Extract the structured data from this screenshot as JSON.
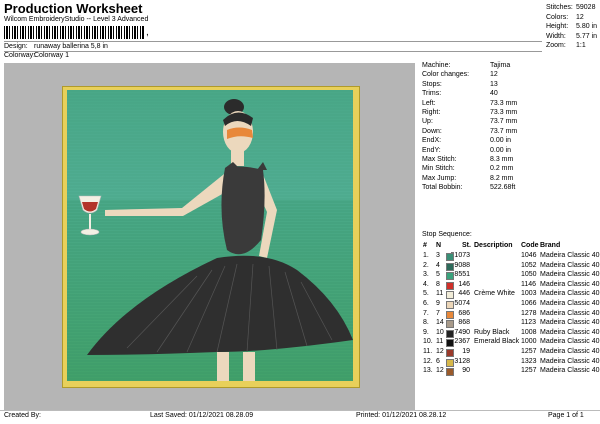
{
  "header": {
    "title": "Production Worksheet",
    "subtitle": "Wilcom EmbroideryStudio -- Level 3 Advanced",
    "barcode_mark": ",",
    "design_label": "Design:",
    "design_value": "runaway ballerina 5,8 in",
    "colorway_label": "Colorway:",
    "colorway_value": "Colorway 1"
  },
  "header_stats": [
    {
      "label": "Stitches:",
      "value": "59028"
    },
    {
      "label": "Colors:",
      "value": "12"
    },
    {
      "label": "Height:",
      "value": "5.80 in"
    },
    {
      "label": "Width:",
      "value": "5.77 in"
    },
    {
      "label": "Zoom:",
      "value": "1:1"
    }
  ],
  "info": [
    {
      "label": "Machine:",
      "value": "Tajima"
    },
    {
      "label": "Color changes:",
      "value": "12"
    },
    {
      "label": "Stops:",
      "value": "13"
    },
    {
      "label": "Trims:",
      "value": "40"
    },
    {
      "label": "Left:",
      "value": "73.3 mm"
    },
    {
      "label": "Right:",
      "value": "73.3 mm"
    },
    {
      "label": "Up:",
      "value": "73.7 mm"
    },
    {
      "label": "Down:",
      "value": "73.7 mm"
    },
    {
      "label": "EndX:",
      "value": "0.00 in"
    },
    {
      "label": "EndY:",
      "value": "0.00 in"
    },
    {
      "label": "Max Stitch:",
      "value": "8.3 mm"
    },
    {
      "label": "Min Stitch:",
      "value": "0.2 mm"
    },
    {
      "label": "Max Jump:",
      "value": "8.2 mm"
    },
    {
      "label": "Total Bobbin:",
      "value": "522.68ft"
    }
  ],
  "stop_sequence_label": "Stop Sequence:",
  "stop_columns": {
    "num": "#",
    "n": "N",
    "st": "St.",
    "description": "Description",
    "code": "Code",
    "brand": "Brand"
  },
  "stops": [
    {
      "num": "1.",
      "n": "3",
      "st": "21073",
      "description": "",
      "code": "1046",
      "brand": "Madeira Classic 40",
      "color": "#3a8f76"
    },
    {
      "num": "2.",
      "n": "4",
      "st": "9088",
      "description": "",
      "code": "1052",
      "brand": "Madeira Classic 40",
      "color": "#2e6a5a"
    },
    {
      "num": "3.",
      "n": "5",
      "st": "8551",
      "description": "",
      "code": "1050",
      "brand": "Madeira Classic 40",
      "color": "#3aa27c"
    },
    {
      "num": "4.",
      "n": "8",
      "st": "146",
      "description": "",
      "code": "1146",
      "brand": "Madeira Classic 40",
      "color": "#d0302a"
    },
    {
      "num": "5.",
      "n": "11",
      "st": "446",
      "description": "Crème White",
      "code": "1003",
      "brand": "Madeira Classic 40",
      "color": "#f1ecd8"
    },
    {
      "num": "6.",
      "n": "9",
      "st": "5074",
      "description": "",
      "code": "1066",
      "brand": "Madeira Classic 40",
      "color": "#ecd6b8"
    },
    {
      "num": "7.",
      "n": "7",
      "st": "686",
      "description": "",
      "code": "1278",
      "brand": "Madeira Classic 40",
      "color": "#e8883a"
    },
    {
      "num": "8.",
      "n": "14",
      "st": "868",
      "description": "",
      "code": "1123",
      "brand": "Madeira Classic 40",
      "color": "#a89a8a"
    },
    {
      "num": "9.",
      "n": "10",
      "st": "7490",
      "description": "Ruby Black",
      "code": "1008",
      "brand": "Madeira Classic 40",
      "color": "#222222"
    },
    {
      "num": "10.",
      "n": "11",
      "st": "2367",
      "description": "Emerald Black",
      "code": "1000",
      "brand": "Madeira Classic 40",
      "color": "#111111"
    },
    {
      "num": "11.",
      "n": "12",
      "st": "19",
      "description": "",
      "code": "1257",
      "brand": "Madeira Classic 40",
      "color": "#9a3a2a"
    },
    {
      "num": "12.",
      "n": "6",
      "st": "3128",
      "description": "",
      "code": "1323",
      "brand": "Madeira Classic 40",
      "color": "#d7b84a"
    },
    {
      "num": "13.",
      "n": "12",
      "st": "90",
      "description": "",
      "code": "1257",
      "brand": "Madeira Classic 40",
      "color": "#9a5a2a"
    }
  ],
  "footer": {
    "created_by": "Created By:",
    "last_saved": "Last Saved: 01/12/2021 08.28.09",
    "printed": "Printed: 01/12/2021 08.28.12",
    "page": "Page 1 of 1"
  },
  "colors": {
    "frame": "#e8d05a",
    "background_gray": "#b5b5b5",
    "green_bg": "#3fa882"
  }
}
